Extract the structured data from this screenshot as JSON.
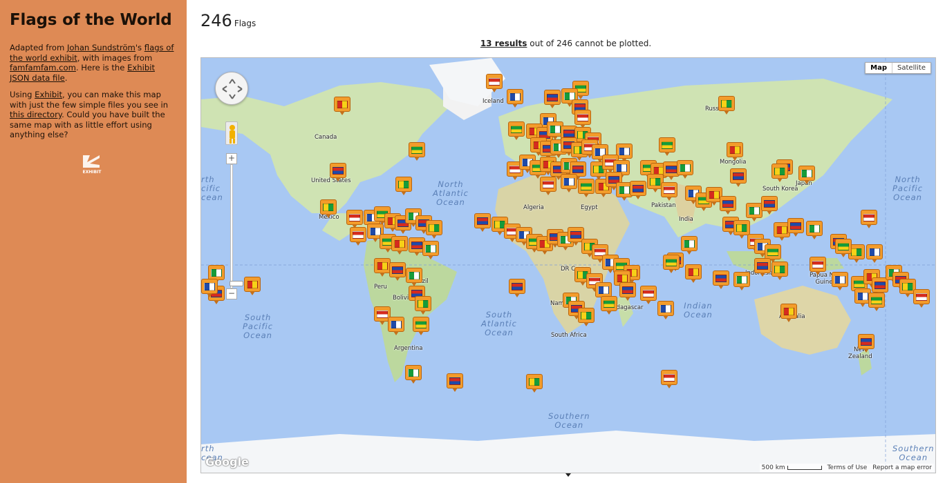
{
  "sidebar": {
    "title": "Flags of the World",
    "p1_pre": "Adapted from ",
    "p1_link1": "Johan Sundström",
    "p1_mid1": "'s ",
    "p1_link2": "flags of the world exhibit",
    "p1_mid2": ", with images from ",
    "p1_link3": "famfamfam.com",
    "p1_mid3": ". Here is the ",
    "p1_link4": "Exhibit JSON data file",
    "p1_end": ".",
    "p2_pre": "Using ",
    "p2_link1": "Exhibit",
    "p2_mid1": ", you can make this map with just the few simple files you see in ",
    "p2_link2": "this directory",
    "p2_end": ". Could you have built the same map with as little effort using anything else?",
    "logo_text": "EXHIBIT"
  },
  "header": {
    "count": "246",
    "count_label": "Flags",
    "results_link": "13 results",
    "results_text": " out of 246 cannot be plotted."
  },
  "map": {
    "type_map": "Map",
    "type_satellite": "Satellite",
    "zoom_in": "+",
    "zoom_out": "−",
    "google": "Google",
    "scale": "500 km",
    "terms": "Terms of Use",
    "report": "Report a map error",
    "oceans": {
      "north_atlantic": "North\nAtlantic\nOcean",
      "south_atlantic": "South\nAtlantic\nOcean",
      "south_pacific": "South\nPacific\nOcean",
      "north_pacific_right": "North\nPacific\nOcean",
      "north_pacific_left": "rth\ncific\ncean",
      "indian": "Indian\nOcean",
      "southern": "Southern\nOcean",
      "southern_left": "rth\ncean",
      "southern_right": "Southern\nOcean"
    },
    "places": {
      "iceland": "Iceland",
      "canada": "Canada",
      "united_states": "United States",
      "mexico": "Mexico",
      "russia": "Russia",
      "mongolia": "Mongolia",
      "south_korea": "South Korea",
      "japan": "Japan",
      "algeria": "Algeria",
      "egypt": "Egypt",
      "pakistan": "Pakistan",
      "india": "India",
      "peru": "Peru",
      "brazil": "Brazil",
      "bolivia": "Bolivia",
      "argentina": "Argentina",
      "dr_congo": "DR Congo",
      "madagascar": "Madagascar",
      "south_africa": "South Africa",
      "namibia": "Namibia",
      "indonesia": "Indonesia",
      "papua_new_guinea": "Papua New\nGuinea",
      "australia": "Australia",
      "new_zealand": "New\nZealand",
      "afghanistan": "Afgh",
      "ukraine": "ine"
    },
    "flag_colors": {
      "orange": "#F39C2B",
      "red": "#d52b1e",
      "blue": "#1f4aa8",
      "green": "#169b3a",
      "yellow": "#f7d117",
      "white": "#ffffff"
    }
  }
}
